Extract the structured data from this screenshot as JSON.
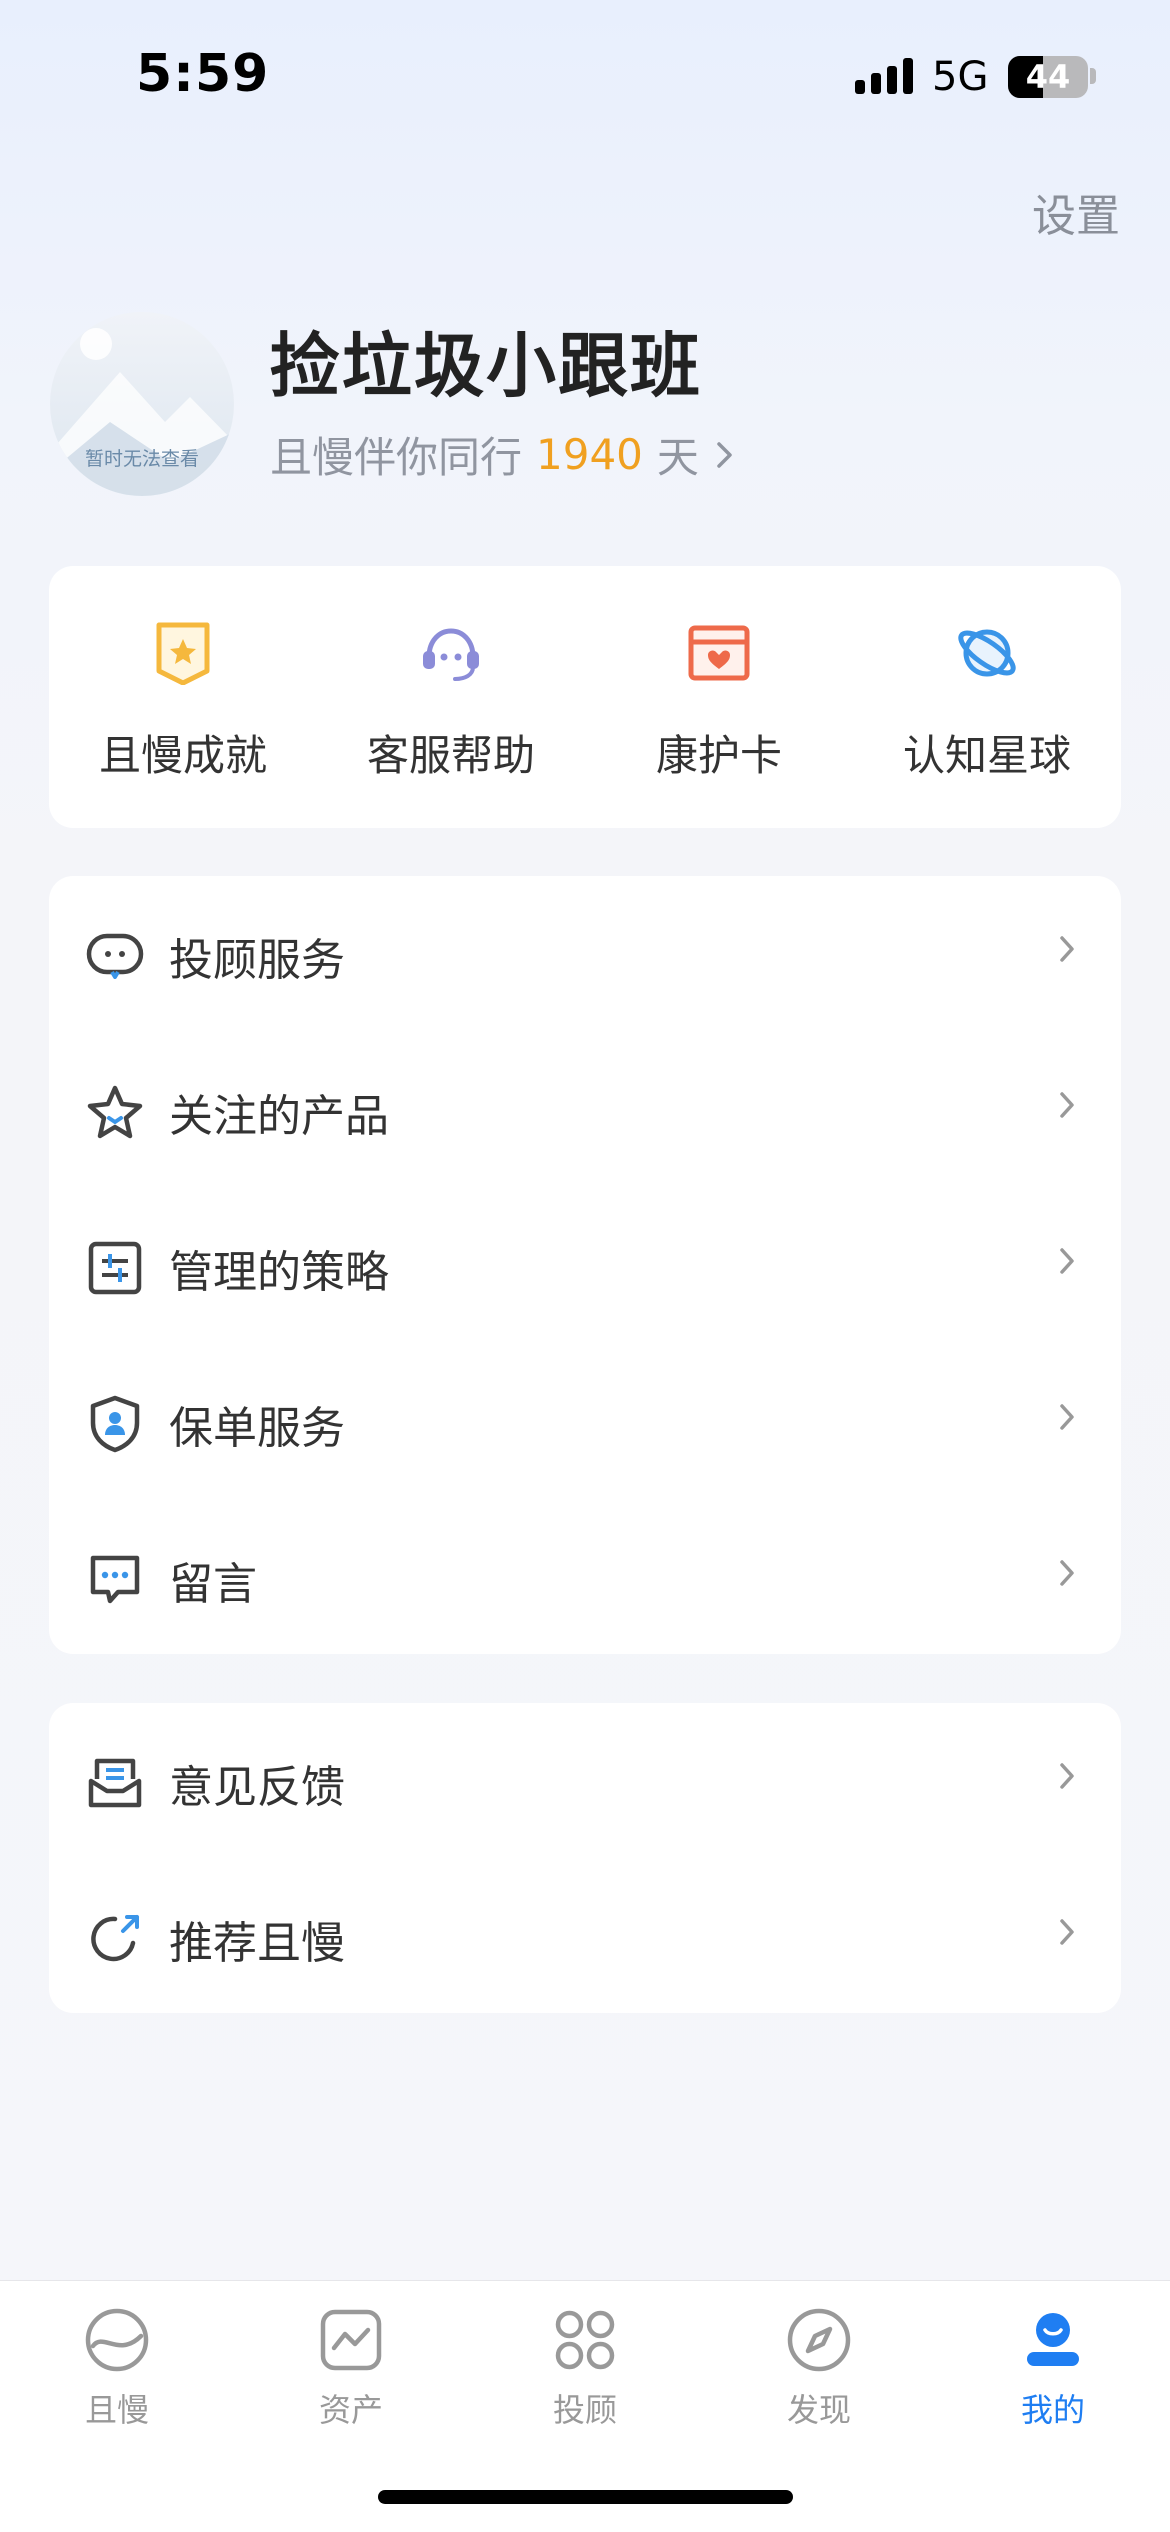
{
  "status_bar": {
    "time": "5:59",
    "network": "5G",
    "battery": "44",
    "battery_level": 0.44
  },
  "header": {
    "settings_label": "设置"
  },
  "profile": {
    "avatar_placeholder_text": "暂时无法查看",
    "username": "捡垃圾小跟班",
    "companion_prefix": "且慢伴你同行",
    "companion_days": "1940",
    "companion_suffix": "天"
  },
  "quick_actions": [
    {
      "label": "且慢成就",
      "icon": "achievement-badge-icon",
      "color": "#f5b83d"
    },
    {
      "label": "客服帮助",
      "icon": "customer-service-headset-icon",
      "color": "#8b8cd8"
    },
    {
      "label": "康护卡",
      "icon": "health-card-icon",
      "color": "#ee6a4a"
    },
    {
      "label": "认知星球",
      "icon": "planet-icon",
      "color": "#3a95e8"
    }
  ],
  "menu_group_1": [
    {
      "label": "投顾服务",
      "icon": "chat-bubble-icon"
    },
    {
      "label": "关注的产品",
      "icon": "star-icon"
    },
    {
      "label": "管理的策略",
      "icon": "strategy-sliders-icon"
    },
    {
      "label": "保单服务",
      "icon": "shield-person-icon"
    },
    {
      "label": "留言",
      "icon": "message-dots-icon"
    }
  ],
  "menu_group_2": [
    {
      "label": "意见反馈",
      "icon": "feedback-inbox-icon"
    },
    {
      "label": "推荐且慢",
      "icon": "share-refresh-icon"
    }
  ],
  "tab_bar": {
    "active_color": "#1f7ef2",
    "tabs": [
      {
        "label": "且慢",
        "icon": "qieman-logo-icon",
        "active": false
      },
      {
        "label": "资产",
        "icon": "assets-chart-icon",
        "active": false
      },
      {
        "label": "投顾",
        "icon": "four-petal-icon",
        "active": false
      },
      {
        "label": "发现",
        "icon": "compass-icon",
        "active": false
      },
      {
        "label": "我的",
        "icon": "me-person-icon",
        "active": true
      }
    ]
  }
}
